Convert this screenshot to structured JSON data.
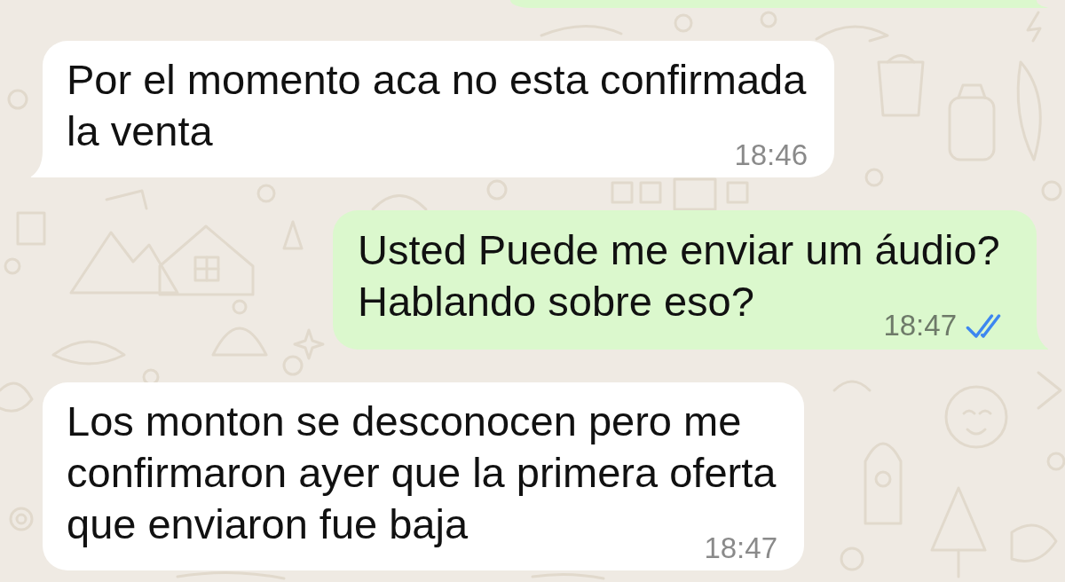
{
  "messages": [
    {
      "kind": "outgoing",
      "cropped": true,
      "tail": true
    },
    {
      "kind": "incoming",
      "cropped": false,
      "tail": true,
      "text": "Por el momento aca no esta confirmada la venta",
      "time": "18:46"
    },
    {
      "kind": "outgoing",
      "cropped": false,
      "tail": true,
      "text": "Usted Puede me enviar um áudio? Hablando sobre eso?",
      "time": "18:47",
      "read": true
    },
    {
      "kind": "incoming",
      "cropped": false,
      "tail": false,
      "text": "Los monton se desconocen pero me confirmaron ayer que la primera oferta que enviaron fue baja",
      "time": "18:47"
    }
  ]
}
